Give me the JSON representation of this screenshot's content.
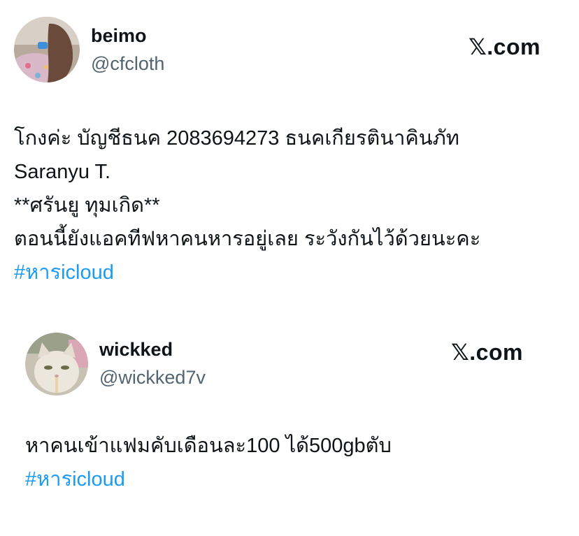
{
  "tweets": [
    {
      "display_name": "beimo",
      "handle": "@cfcloth",
      "brand": "𝕏.com",
      "lines": [
        "โกงค่ะ  บัญชีธนค 2083694273 ธนคเกียรตินาคินภัท",
        "Saranyu T.",
        "**ศรันยู ทุมเกิด**",
        "ตอนนี้ยังแอคทีฟหาคนหารอยู่เลย ระวังกันไว้ด้วยนะคะ"
      ],
      "hashtag": "#หารicloud",
      "avatar_icon": "profile-photo"
    },
    {
      "display_name": "wickked",
      "handle": "@wickked7v",
      "brand": "𝕏.com",
      "lines": [
        "หาคนเข้าแฟมคับเดือนละ100 ได้500gbตับ"
      ],
      "hashtag": "#หารicloud",
      "avatar_icon": "cat-profile-photo"
    }
  ],
  "colors": {
    "text": "#0f1419",
    "handle": "#536471",
    "hashtag": "#1d9bf0"
  }
}
